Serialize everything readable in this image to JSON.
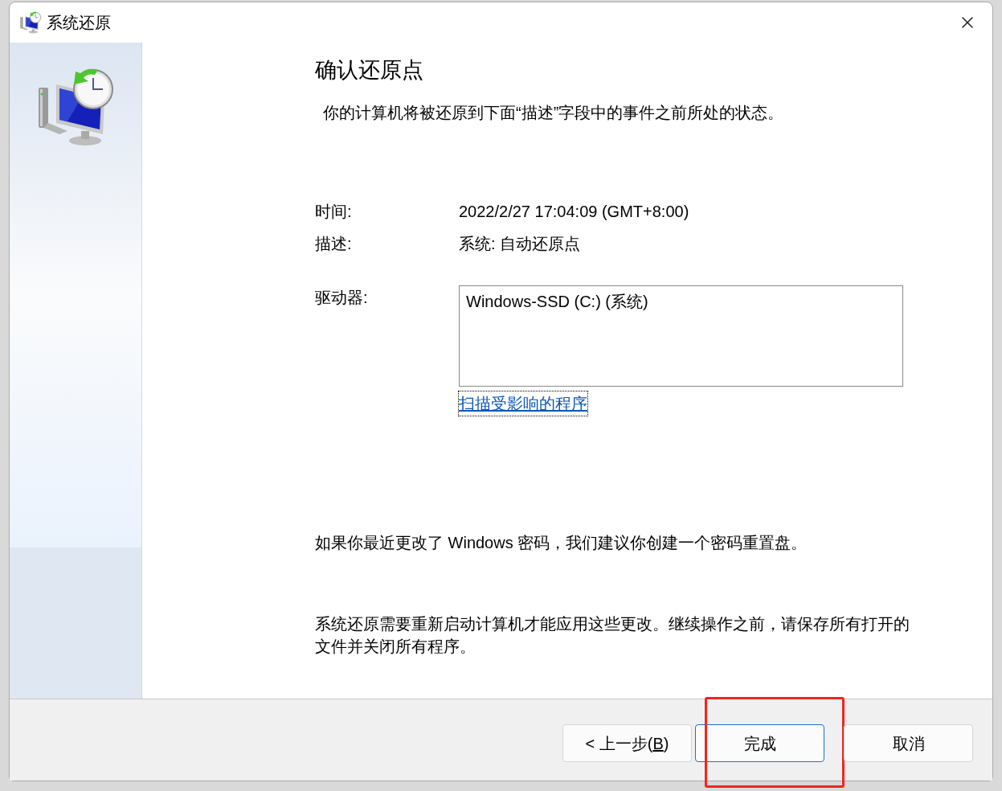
{
  "window": {
    "title": "系统还原"
  },
  "heading": "确认还原点",
  "intro": "你的计算机将被还原到下面“描述”字段中的事件之前所处的状态。",
  "fields": [
    {
      "label": "时间:",
      "value": "2022/2/27 17:04:09 (GMT+8:00)"
    },
    {
      "label": "描述:",
      "value": "系统: 自动还原点"
    }
  ],
  "drives": {
    "label": "驱动器:",
    "items": [
      "Windows-SSD (C:) (系统)"
    ]
  },
  "scan_link": "扫描受影响的程序",
  "notes": [
    "如果你最近更改了 Windows 密码，我们建议你创建一个密码重置盘。",
    "系统还原需要重新启动计算机才能应用这些更改。继续操作之前，请保存所有打开的文件并关闭所有程序。"
  ],
  "buttons": [
    {
      "label": "< 上一步(",
      "access_key": "B",
      "label_after": ")",
      "default": false,
      "highlighted": false
    },
    {
      "label": "完成",
      "default": true,
      "highlighted": true
    },
    {
      "label": "取消",
      "default": false,
      "highlighted": false
    }
  ]
}
